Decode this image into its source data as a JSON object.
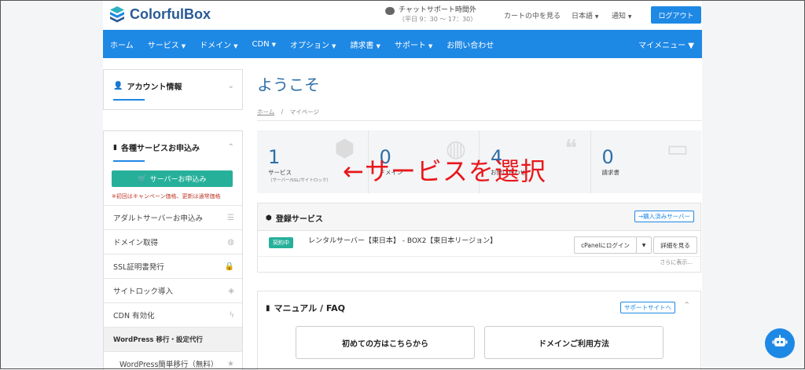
{
  "header": {
    "logo_text": "ColorfulBox",
    "support_title": "チャットサポート時間外",
    "support_hours": "（平日 9：30 〜 17：30）",
    "cart": "カートの中を見る",
    "language": "日本語",
    "notifications": "通知",
    "logout": "ログアウト"
  },
  "nav": {
    "items": [
      {
        "label": "ホーム",
        "caret": ""
      },
      {
        "label": "サービス",
        "caret": "▼"
      },
      {
        "label": "ドメイン",
        "caret": "▼"
      },
      {
        "label": "CDN",
        "caret": "▼"
      },
      {
        "label": "オプション",
        "caret": "▼"
      },
      {
        "label": "請求書",
        "caret": "▼"
      },
      {
        "label": "サポート",
        "caret": "▼"
      },
      {
        "label": "お問い合わせ",
        "caret": ""
      }
    ],
    "my_menu": "マイメニュー ▼"
  },
  "sidebar": {
    "account": "アカウント情報",
    "apply_title": "各種サービスお申込み",
    "server_button": "サーバーお申込み",
    "note": "※初回はキャンペーン価格、更新は通常価格",
    "items": [
      {
        "label": "アダルトサーバーお申込み",
        "icon": "server-icon"
      },
      {
        "label": "ドメイン取得",
        "icon": "globe-icon"
      },
      {
        "label": "SSL証明書発行",
        "icon": "lock-icon"
      },
      {
        "label": "サイトロック導入",
        "icon": "shield-icon"
      },
      {
        "label": "CDN 有効化",
        "icon": "bolt-icon"
      }
    ],
    "wp_header": "WordPress 移行・設定代行",
    "wp_item": "WordPress簡単移行（無料）"
  },
  "main": {
    "welcome": "ようこそ",
    "breadcrumb_home": "ホーム",
    "breadcrumb_sep": "/",
    "breadcrumb_current": "マイページ",
    "stats": [
      {
        "num": "1",
        "label": "サービス",
        "sub": "（サーバー/SSL/サイトロック）",
        "icon": "box-icon"
      },
      {
        "num": "0",
        "label": "ドメイン",
        "sub": "",
        "icon": "globe-icon"
      },
      {
        "num": "4",
        "label": "お問い合わせ",
        "sub": "",
        "icon": "chat-icon"
      },
      {
        "num": "0",
        "label": "請求書",
        "sub": "",
        "icon": "card-icon"
      }
    ],
    "overlay_text": "←サービスを選択",
    "services": {
      "title": "登録サービス",
      "purchased_link": "→購入済みサーバー",
      "status": "契約中",
      "name": "レンタルサーバー【東日本】 - BOX2【東日本リージョン】",
      "cpanel": "cPanelにログイン",
      "details": "詳細を見る",
      "more": "さらに表示..."
    },
    "manual": {
      "title": "マニュアル / FAQ",
      "support_site": "サポートサイトへ",
      "btn1": "初めての方はこちらから",
      "btn2": "ドメインご利用方法"
    }
  },
  "colors": {
    "primary": "#1e88e5",
    "green": "#26b09a",
    "title_blue": "#2e6fa8",
    "overlay_red": "#e8171b"
  }
}
